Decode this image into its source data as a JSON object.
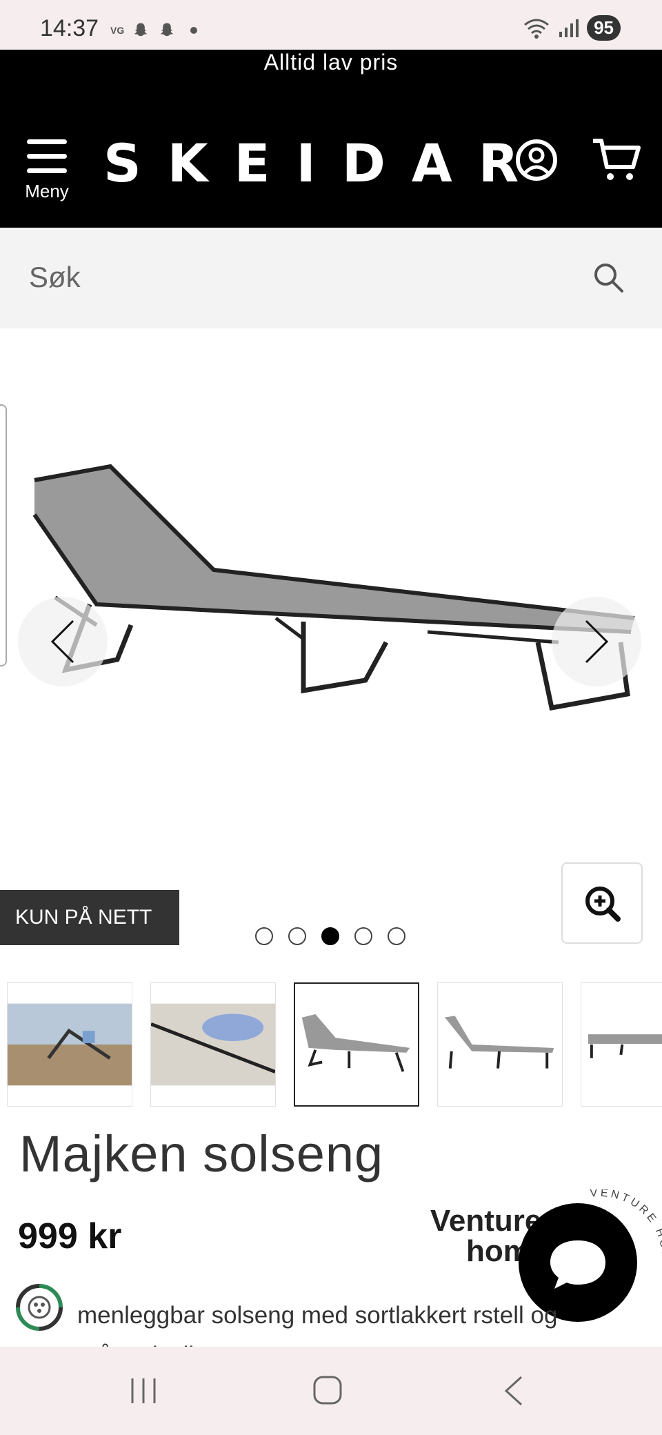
{
  "status_bar": {
    "time": "14:37",
    "vg_label": "VG",
    "battery": "95"
  },
  "header": {
    "promo": "Alltid lav pris",
    "menu_label": "Meny",
    "logo": "SKEIDAR"
  },
  "search": {
    "placeholder": "Søk"
  },
  "gallery": {
    "badge": "KUN PÅ NETT",
    "dots_total": 5,
    "active_dot_index": 2,
    "thumbnails_selected_index": 2
  },
  "product": {
    "title": "Majken solseng",
    "price": "999 kr",
    "brand_line1": "Venture",
    "brand_line2": "home",
    "brand_ring_text": "VENTURE HOME",
    "description": "menleggbar solseng med sortlakkert rstell og grått tekstil"
  },
  "colors": {
    "header_bg": "#000000",
    "search_bg": "#f3f3f3",
    "badge_bg": "#333333",
    "eco_green": "#2e8b57"
  }
}
